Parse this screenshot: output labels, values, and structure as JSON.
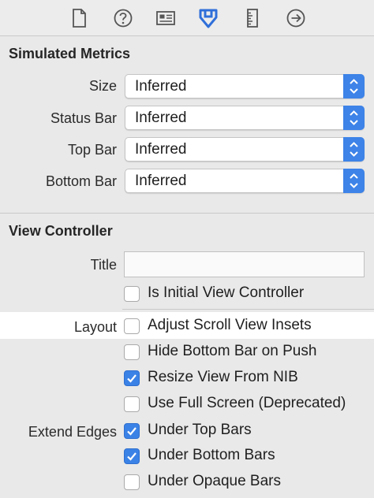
{
  "toolbar": {
    "icons": [
      "file-icon",
      "help-icon",
      "identity-icon",
      "attributes-icon",
      "ruler-icon",
      "connections-icon"
    ],
    "active_color": "#2f6fd9"
  },
  "simulated_metrics": {
    "title": "Simulated Metrics",
    "rows": [
      {
        "label": "Size",
        "value": "Inferred"
      },
      {
        "label": "Status Bar",
        "value": "Inferred"
      },
      {
        "label": "Top Bar",
        "value": "Inferred"
      },
      {
        "label": "Bottom Bar",
        "value": "Inferred"
      }
    ]
  },
  "view_controller": {
    "title": "View Controller",
    "title_label": "Title",
    "title_value": "",
    "is_initial": {
      "label": "Is Initial View Controller",
      "checked": false
    },
    "layout_label": "Layout",
    "layout": [
      {
        "label": "Adjust Scroll View Insets",
        "checked": false
      },
      {
        "label": "Hide Bottom Bar on Push",
        "checked": false
      },
      {
        "label": "Resize View From NIB",
        "checked": true
      },
      {
        "label": "Use Full Screen (Deprecated)",
        "checked": false
      }
    ],
    "extend_edges_label": "Extend Edges",
    "extend_edges": [
      {
        "label": "Under Top Bars",
        "checked": true
      },
      {
        "label": "Under Bottom Bars",
        "checked": true
      },
      {
        "label": "Under Opaque Bars",
        "checked": false
      }
    ]
  },
  "colors": {
    "accent": "#3b82e6",
    "highlight_row": "#ffffff"
  }
}
